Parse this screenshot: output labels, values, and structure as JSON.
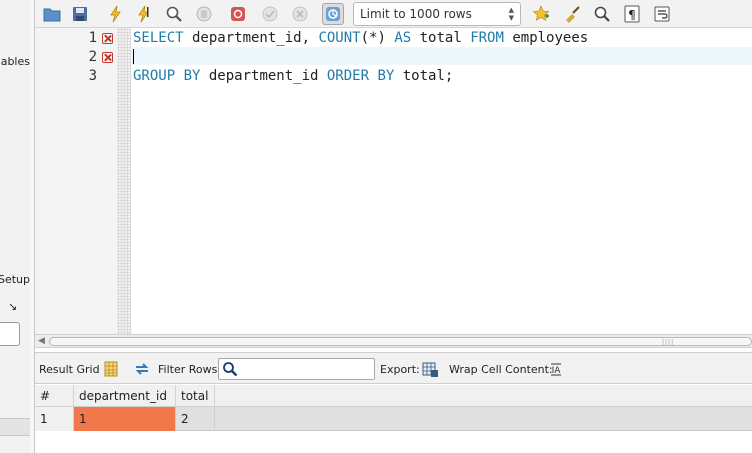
{
  "sidebar": {
    "fragment_top": "iables",
    "fragment_setup": "Setup",
    "fragment_expand": "↘"
  },
  "toolbar": {
    "limit_select_value": "Limit to 1000 rows"
  },
  "editor": {
    "line_numbers": [
      "1",
      "2",
      "3"
    ],
    "line1": {
      "t1": "SELECT",
      "t2": " department_id, ",
      "t3": "COUNT",
      "t4": "(*) ",
      "t5": "AS",
      "t6": " total ",
      "t7": "FROM",
      "t8": " employees"
    },
    "line2": "",
    "line3": {
      "t1": "GROUP BY",
      "t2": " department_id ",
      "t3": "ORDER BY",
      "t4": " total;"
    }
  },
  "results_toolbar": {
    "result_grid_label": "Result Grid",
    "filter_rows_label": "Filter Rows:",
    "filter_value": "",
    "export_label": "Export:",
    "wrap_label": "Wrap Cell Content:"
  },
  "grid": {
    "columns": [
      "#",
      "department_id",
      "total"
    ],
    "rows": [
      [
        "1",
        "1",
        "2"
      ]
    ]
  },
  "colors": {
    "keyword": "#1f7ba8",
    "selected_cell": "#f1784a",
    "error_marker": "#c0392b"
  }
}
